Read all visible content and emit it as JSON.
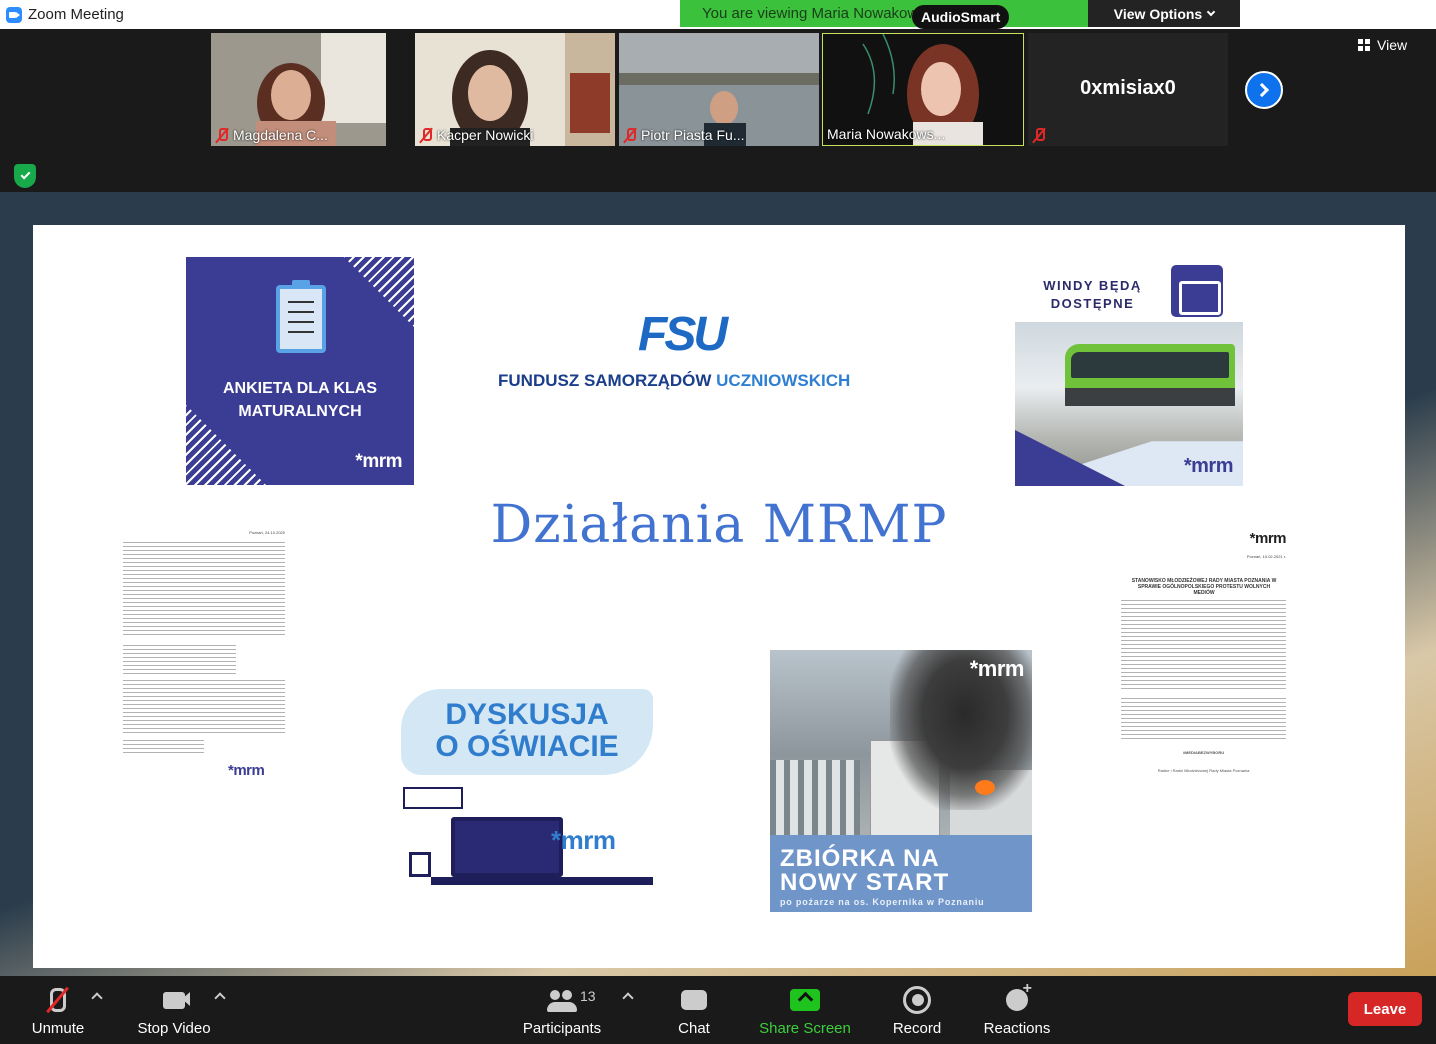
{
  "window": {
    "title": "Zoom Meeting"
  },
  "banner": {
    "viewing_text": "You are viewing Maria Nowakowska's screen",
    "view_options_label": "View Options",
    "audiosmart_label": "AudioSmart"
  },
  "gallery": {
    "view_label": "View",
    "participants": [
      {
        "name": "Magdalena C...",
        "muted": true
      },
      {
        "name": "Kacper Nowicki",
        "muted": true
      },
      {
        "name": "Piotr Piasta Fu...",
        "muted": true
      },
      {
        "name": "Maria Nowakows...",
        "muted": false
      },
      {
        "name": "0xmisiax0",
        "muted": true
      }
    ]
  },
  "slide": {
    "heading": "Działania MRMP",
    "ankieta": {
      "text": "ANKIETA DLA KLAS MATURALNYCH",
      "brand": "*mrm"
    },
    "fsu": {
      "logo": "FSU",
      "title_main": "FUNDUSZ SAMORZĄDÓW ",
      "title_highlight": "UCZNIOWSKICH"
    },
    "windy": {
      "title": "WINDY BĘDĄ DOSTĘPNE",
      "brand": "*mrm"
    },
    "letter_left": {
      "date": "Poznań, 24.10.2020",
      "brand": "*mrm"
    },
    "letter_right": {
      "brand": "*mrm",
      "date": "Poznań, 10.02.2021 r.",
      "header": "STANOWISKO MŁODZIEŻOWEJ RADY MIASTA POZNANIA W SPRAWIE OGÓLNOPOLSKIEGO PROTESTU WOLNYCH MEDIÓW",
      "hashtag": "#MEDIABEZWYBORU",
      "signature": "Radne i Radni Młodzieżowej Rady Miasta Poznania"
    },
    "dyskusja": {
      "line1": "DYSKUSJA",
      "line2": "O OŚWIACIE",
      "brand": "*mrm"
    },
    "zbiorka": {
      "line1": "ZBIÓRKA NA",
      "line2": "NOWY START",
      "subtitle": "po pożarze na os. Kopernika w Poznaniu",
      "brand": "*mrm"
    }
  },
  "toolbar": {
    "unmute": "Unmute",
    "stop_video": "Stop Video",
    "participants": "Participants",
    "participants_count": "13",
    "chat": "Chat",
    "share_screen": "Share Screen",
    "record": "Record",
    "reactions": "Reactions",
    "leave": "Leave"
  }
}
